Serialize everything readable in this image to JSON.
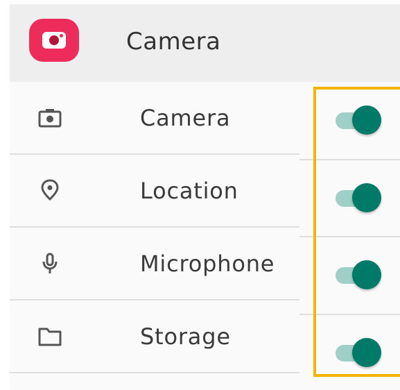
{
  "header": {
    "title": "Camera",
    "app_icon": "camera-app-icon",
    "app_icon_color": "#ee2c5b",
    "background": "#eeeeee"
  },
  "permissions": [
    {
      "label": "Camera",
      "icon": "camera-icon",
      "enabled": true
    },
    {
      "label": "Location",
      "icon": "location-pin-icon",
      "enabled": true
    },
    {
      "label": "Microphone",
      "icon": "microphone-icon",
      "enabled": true
    },
    {
      "label": "Storage",
      "icon": "folder-icon",
      "enabled": true
    }
  ],
  "colors": {
    "toggle_thumb": "#007a68",
    "toggle_track": "#9fcfc6",
    "highlight_border": "#f2b400",
    "text": "#3a3a3a",
    "icon": "#555555"
  }
}
